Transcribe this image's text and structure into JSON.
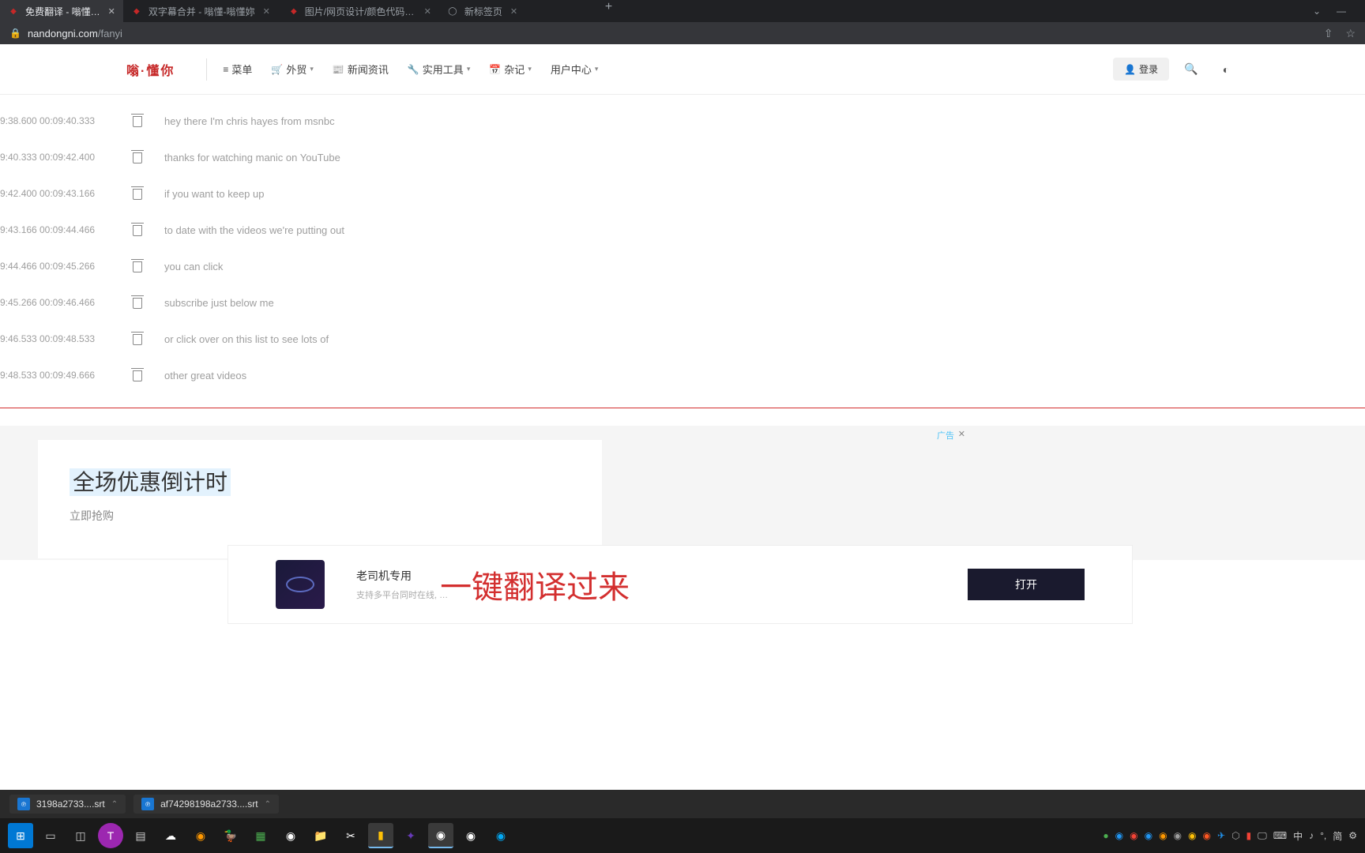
{
  "browser": {
    "tabs": [
      {
        "title": "免费翻译 - 嗡懂…",
        "active": true,
        "favicon_color": "#c62828"
      },
      {
        "title": "双字幕合并 - 嗡懂-嗡懂妳",
        "active": false,
        "favicon_color": "#c62828"
      },
      {
        "title": "图片/网页设计/颜色代码对照表-",
        "active": false,
        "favicon_color": "#c62828"
      },
      {
        "title": "新标签页",
        "active": false,
        "favicon_color": "#9aa0a6"
      }
    ],
    "url_host": "nandongni.com",
    "url_path": "/fanyi"
  },
  "header": {
    "logo": "嗡·懂你",
    "nav": [
      {
        "label": "菜单",
        "icon": "≡",
        "chev": false
      },
      {
        "label": "外贸",
        "icon": "🛒",
        "chev": true
      },
      {
        "label": "新闻资讯",
        "icon": "📰",
        "chev": false
      },
      {
        "label": "实用工具",
        "icon": "🔧",
        "chev": true
      },
      {
        "label": "杂记",
        "icon": "📅",
        "chev": true
      },
      {
        "label": "用户中心",
        "icon": "",
        "chev": true
      }
    ],
    "login_label": "登录"
  },
  "subtitles": [
    {
      "t1": "9:38.600",
      "t2": "00:09:40.333",
      "text": "hey there I'm chris hayes from msnbc"
    },
    {
      "t1": "9:40.333",
      "t2": "00:09:42.400",
      "text": "thanks for watching manic on YouTube"
    },
    {
      "t1": "9:42.400",
      "t2": "00:09:43.166",
      "text": "if you want to keep up"
    },
    {
      "t1": "9:43.166",
      "t2": "00:09:44.466",
      "text": "to date with the videos we're putting out"
    },
    {
      "t1": "9:44.466",
      "t2": "00:09:45.266",
      "text": "you can click"
    },
    {
      "t1": "9:45.266",
      "t2": "00:09:46.466",
      "text": "subscribe just below me"
    },
    {
      "t1": "9:46.533",
      "t2": "00:09:48.533",
      "text": "or click over on this list to see lots of"
    },
    {
      "t1": "9:48.533",
      "t2": "00:09:49.666",
      "text": "other great videos"
    }
  ],
  "ad": {
    "label": "广告",
    "title": "全场优惠倒计时",
    "subtitle": "立即抢购"
  },
  "banner": {
    "title": "老司机专用",
    "sub": "支持多平台同时在线, …",
    "red_text": "一键翻译过来",
    "btn": "打开"
  },
  "downloads": [
    {
      "name": "3198a2733....srt"
    },
    {
      "name": "af74298198a2733....srt"
    }
  ],
  "tray": {
    "ime": "中",
    "ime2": "简",
    "layout": "⌨"
  }
}
